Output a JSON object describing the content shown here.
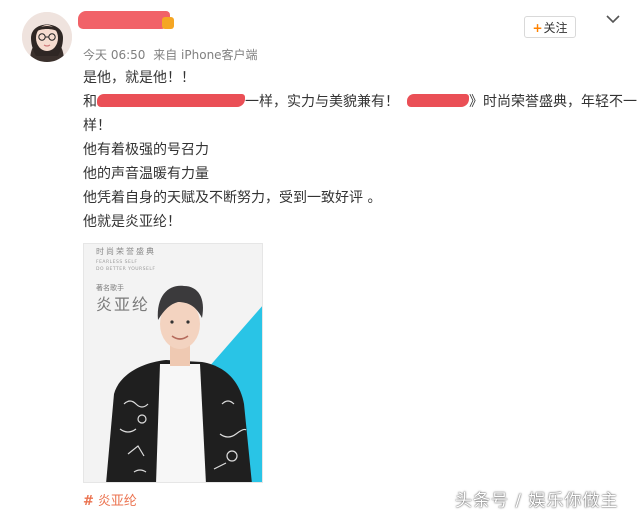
{
  "post": {
    "meta": {
      "time": "今天 06:50",
      "source": "来自 iPhone客户端"
    },
    "follow_label": "关注",
    "lines": {
      "l1": "是他，就是他！！",
      "l2a": "和",
      "l2b": "一样，实力与美貌兼有！",
      "l2c": "》时尚荣誉盛典，年轻不一",
      "l3": "样！",
      "l4": "他有着极强的号召力",
      "l5": "他的声音温暖有力量",
      "l6": "他凭着自身的天赋及不断努力，受到一致好评 。",
      "l7": "他就是炎亚纶！"
    },
    "topic": "炎亚纶"
  },
  "poster": {
    "title": "时尚荣誉盛典",
    "eng1": "FEARLESS SELF",
    "eng2": "DO BETTER YOURSELF",
    "role": "著名歌手",
    "name": "炎亚纶"
  },
  "watermark": "头条号 / 娱乐你做主",
  "colors": {
    "accent_orange": "#ff8200",
    "topic_color": "#eb7350",
    "redaction_red": "#ea4f56",
    "poster_cyan": "#29c4e6"
  }
}
